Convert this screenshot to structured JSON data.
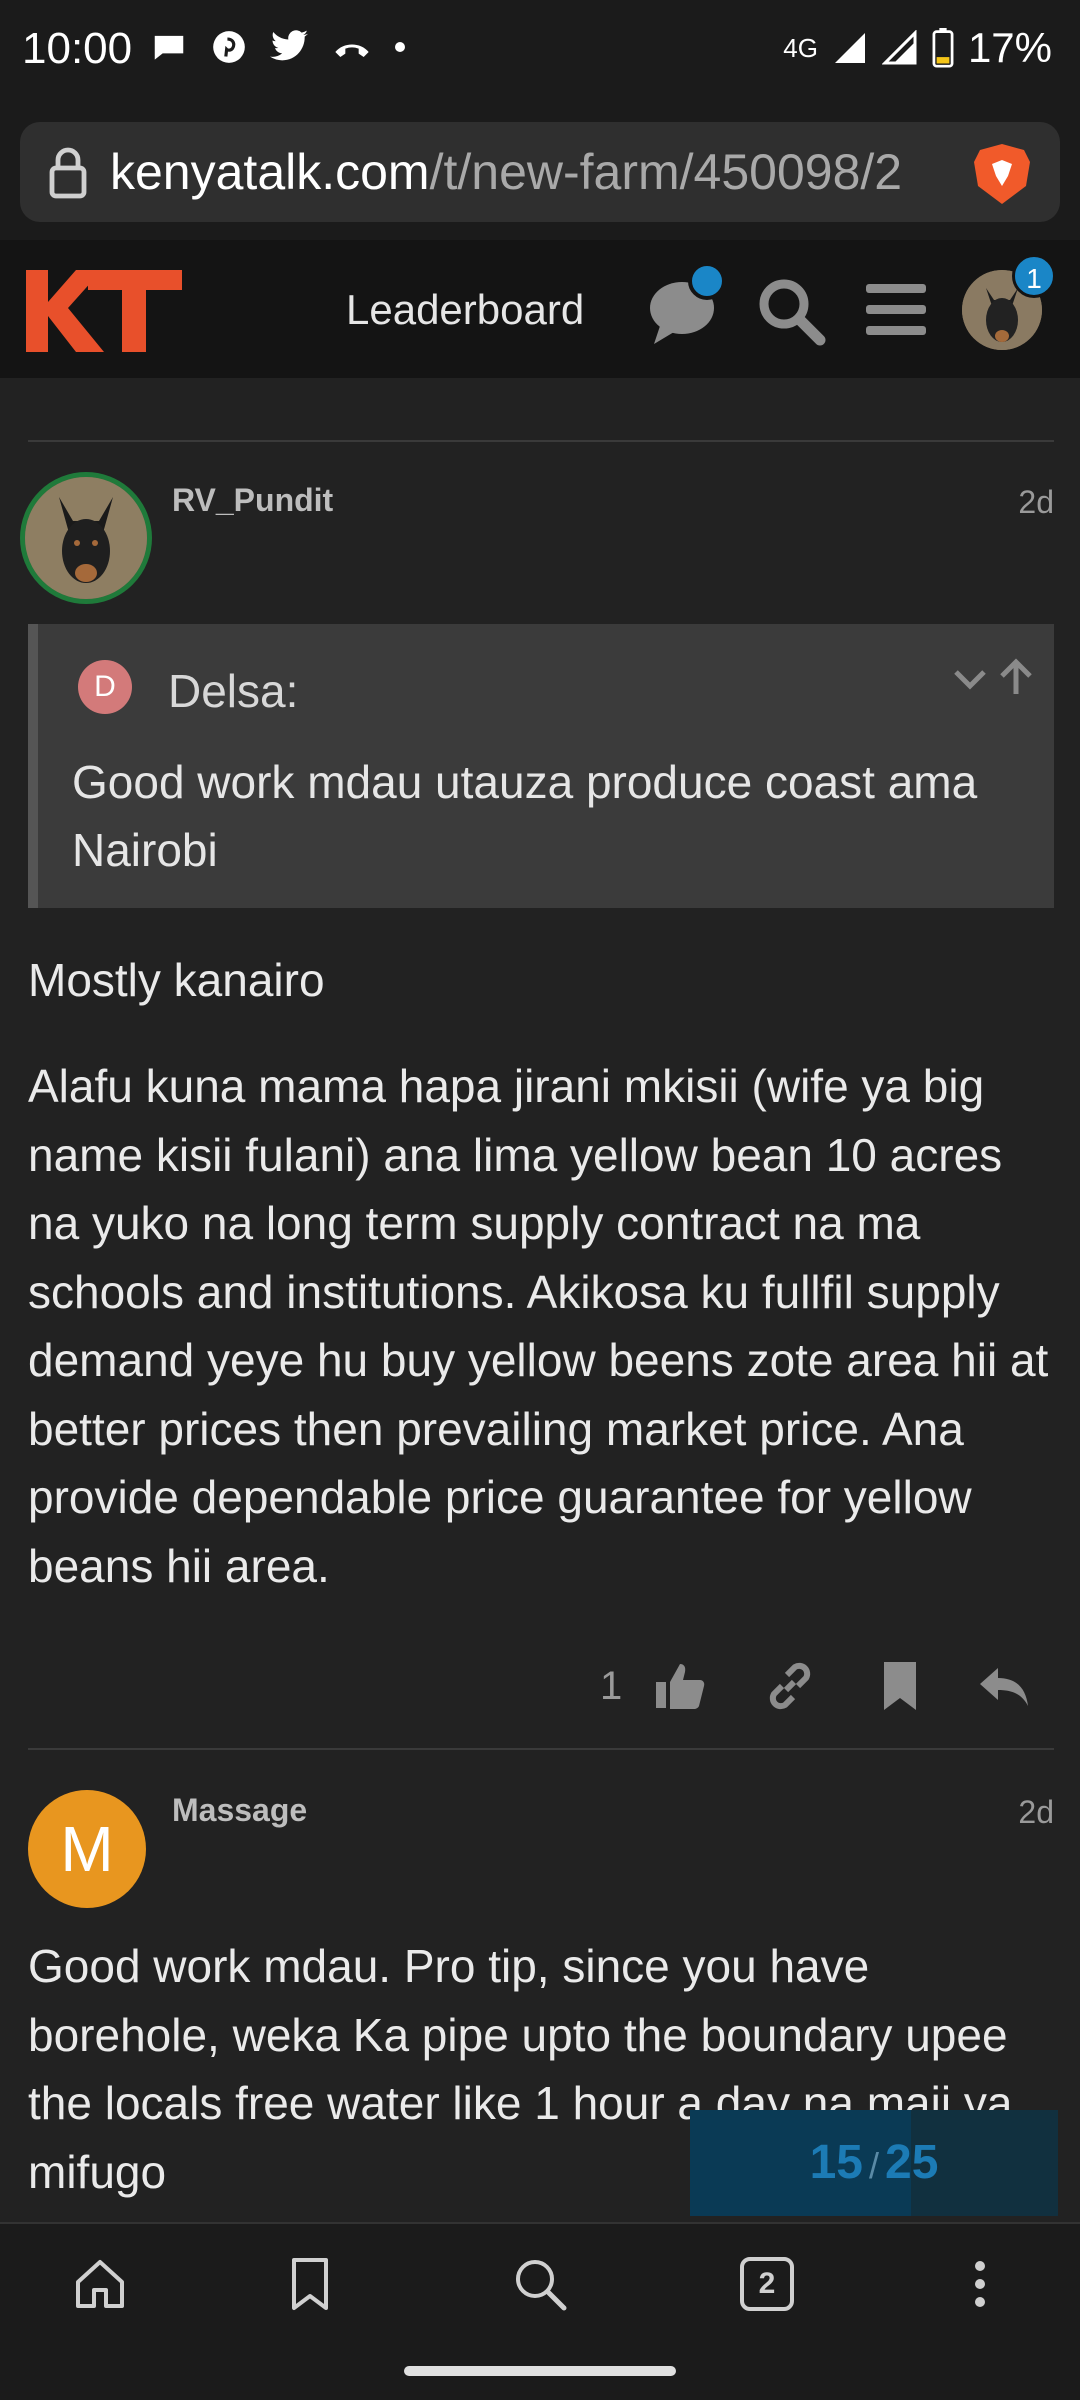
{
  "status_bar": {
    "time": "10:00",
    "network": "4G",
    "battery": "17%"
  },
  "browser": {
    "url_host": "kenyatalk.com",
    "url_path": "/t/new-farm/450098/2",
    "open_tabs": "2"
  },
  "header": {
    "logo_text": "KT",
    "leaderboard_label": "Leaderboard",
    "notification_count": "1",
    "accent_color": "#e8502b",
    "badge_color": "#1a86c7"
  },
  "posts": [
    {
      "username": "RV_Pundit",
      "time": "2d",
      "quote": {
        "avatar_letter": "D",
        "author": "Delsa:",
        "text": "Good work mdau utauza produce coast ama Nairobi"
      },
      "paragraphs": [
        "Mostly kanairo",
        "Alafu kuna mama hapa jirani mkisii (wife ya big name kisii fulani) ana lima yellow bean 10 acres na yuko na long term supply contract na ma schools and institutions. Akikosa ku fullfil supply demand yeye hu buy yellow beens zote area hii at better prices then prevailing market price. Ana provide dependable price guarantee for yellow beans hii area."
      ],
      "like_count": "1"
    },
    {
      "username": "Massage",
      "time": "2d",
      "avatar_letter": "M",
      "paragraphs": [
        "Good work mdau. Pro tip, since you have borehole, weka Ka pipe upto the boundary upee the locals free water like 1 hour a day na maji ya mifugo"
      ]
    }
  ],
  "progress": {
    "current": "15",
    "separator": "/",
    "total": "25",
    "fraction": 0.6
  }
}
